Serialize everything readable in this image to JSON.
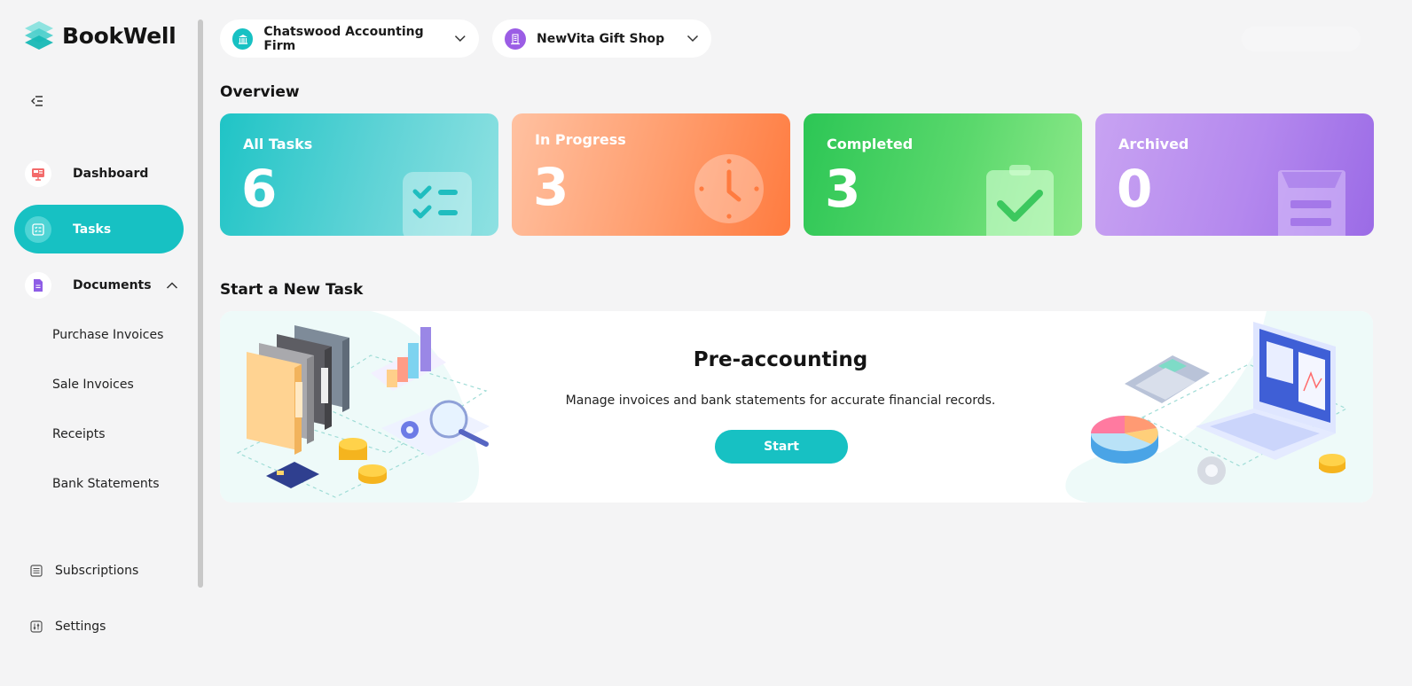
{
  "app": {
    "name": "BookWell"
  },
  "sidebar": {
    "nav": [
      {
        "label": "Dashboard",
        "icon": "presentation-icon",
        "active": false
      },
      {
        "label": "Tasks",
        "icon": "task-list-icon",
        "active": true
      },
      {
        "label": "Documents",
        "icon": "document-icon",
        "active": false,
        "expanded": true
      }
    ],
    "documents_sub": [
      "Purchase Invoices",
      "Sale Invoices",
      "Receipts",
      "Bank Statements"
    ],
    "bottom": [
      {
        "label": "Subscriptions",
        "icon": "list-icon"
      },
      {
        "label": "Settings",
        "icon": "sliders-icon"
      }
    ]
  },
  "header": {
    "firm_selector": {
      "label": "Chatswood Accounting Firm",
      "icon": "building-icon",
      "color": "#17c1c3"
    },
    "client_selector": {
      "label": "NewVita Gift Shop",
      "icon": "office-icon",
      "color": "#9b5de5"
    }
  },
  "overview": {
    "title": "Overview",
    "cards": {
      "all": {
        "label": "All Tasks",
        "count": "6"
      },
      "in_progress": {
        "label": "In Progress",
        "count": "3"
      },
      "completed": {
        "label": "Completed",
        "count": "3"
      },
      "archived": {
        "label": "Archived",
        "count": "0"
      }
    }
  },
  "new_task": {
    "title": "Start a New Task",
    "banner_title": "Pre-accounting",
    "banner_desc": "Manage invoices and bank statements for accurate financial records.",
    "start_label": "Start"
  },
  "colors": {
    "accent": "#17c1c3",
    "all": "#1fc4c6",
    "progress": "#ff8a50",
    "completed": "#3ccf5e",
    "archived": "#b184ed"
  }
}
